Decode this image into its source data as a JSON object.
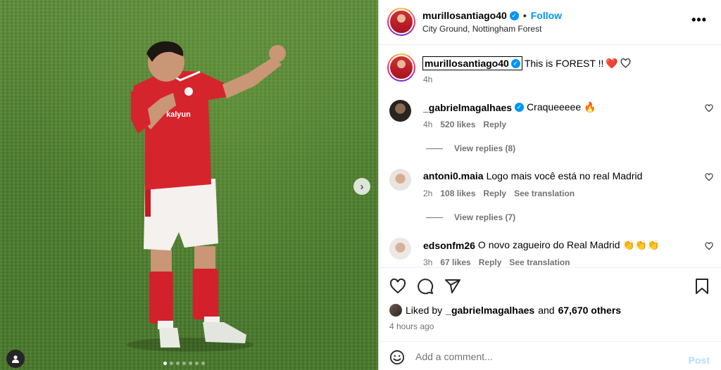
{
  "post": {
    "username": "murillosantiago40",
    "follow_label": "Follow",
    "location": "City Ground, Nottingham Forest",
    "more_label": "•••",
    "separator": "•",
    "image_count": 7,
    "active_image_index": 0
  },
  "caption": {
    "username": "murillosantiago40",
    "text": "This is FOREST !!",
    "emoji": "❤️",
    "time": "4h"
  },
  "comments": [
    {
      "username": "_gabrielmagalhaes",
      "verified": true,
      "text": "Craqueeeee 🔥",
      "time": "4h",
      "likes": "520 likes",
      "reply_label": "Reply",
      "translate_label": "",
      "view_replies": "View replies (8)"
    },
    {
      "username": "antoni0.maia",
      "verified": false,
      "text": "Logo mais você está no real Madrid",
      "time": "2h",
      "likes": "108 likes",
      "reply_label": "Reply",
      "translate_label": "See translation",
      "view_replies": "View replies (7)"
    },
    {
      "username": "edsonfm26",
      "verified": false,
      "text": "O novo zagueiro do Real Madrid 👏👏👏",
      "time": "3h",
      "likes": "67 likes",
      "reply_label": "Reply",
      "translate_label": "See translation",
      "view_replies": ""
    }
  ],
  "likes_bar": {
    "prefix": "Liked by",
    "user": "_gabrielmagalhaes",
    "and": "and",
    "others": "67,670 others",
    "posted": "4 hours ago"
  },
  "composer": {
    "placeholder": "Add a comment...",
    "post_label": "Post"
  },
  "colors": {
    "accent": "#0095f6",
    "like_red": "#ed4956",
    "post_disabled": "#b2dffc"
  }
}
